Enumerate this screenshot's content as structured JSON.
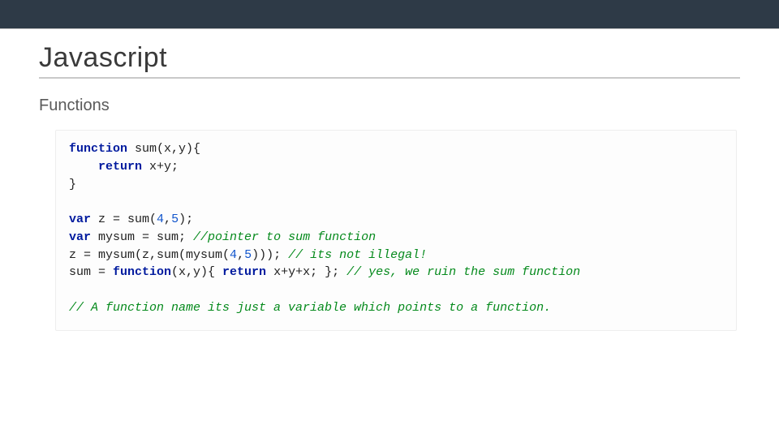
{
  "header": {
    "title": "Javascript",
    "subtitle": "Functions"
  },
  "code": {
    "kw_function": "function",
    "kw_return": "return",
    "kw_var": "var",
    "fn_def_sig": " sum(x,y){",
    "fn_def_ret_expr": " x+y;",
    "fn_def_close": "}",
    "indent": "    ",
    "line_z_decl_prefix": " z = sum(",
    "num_4": "4",
    "num_5": "5",
    "comma": ",",
    "line_z_decl_suffix": ");",
    "line_mysum_decl": " mysum = sum; ",
    "cm_pointer": "//pointer to sum function",
    "line_zcall": "z = mysum(z,sum(mysum(",
    "line_zcall_suffix": "))); ",
    "cm_illegal": "// its not illegal!",
    "line_sum_reassign_a": "sum = ",
    "line_sum_reassign_b": "(x,y){ ",
    "line_sum_reassign_c": " x+y+x; }; ",
    "cm_ruin": "// yes, we ruin the sum function",
    "cm_final": "// A function name its just a variable which points to a function."
  }
}
